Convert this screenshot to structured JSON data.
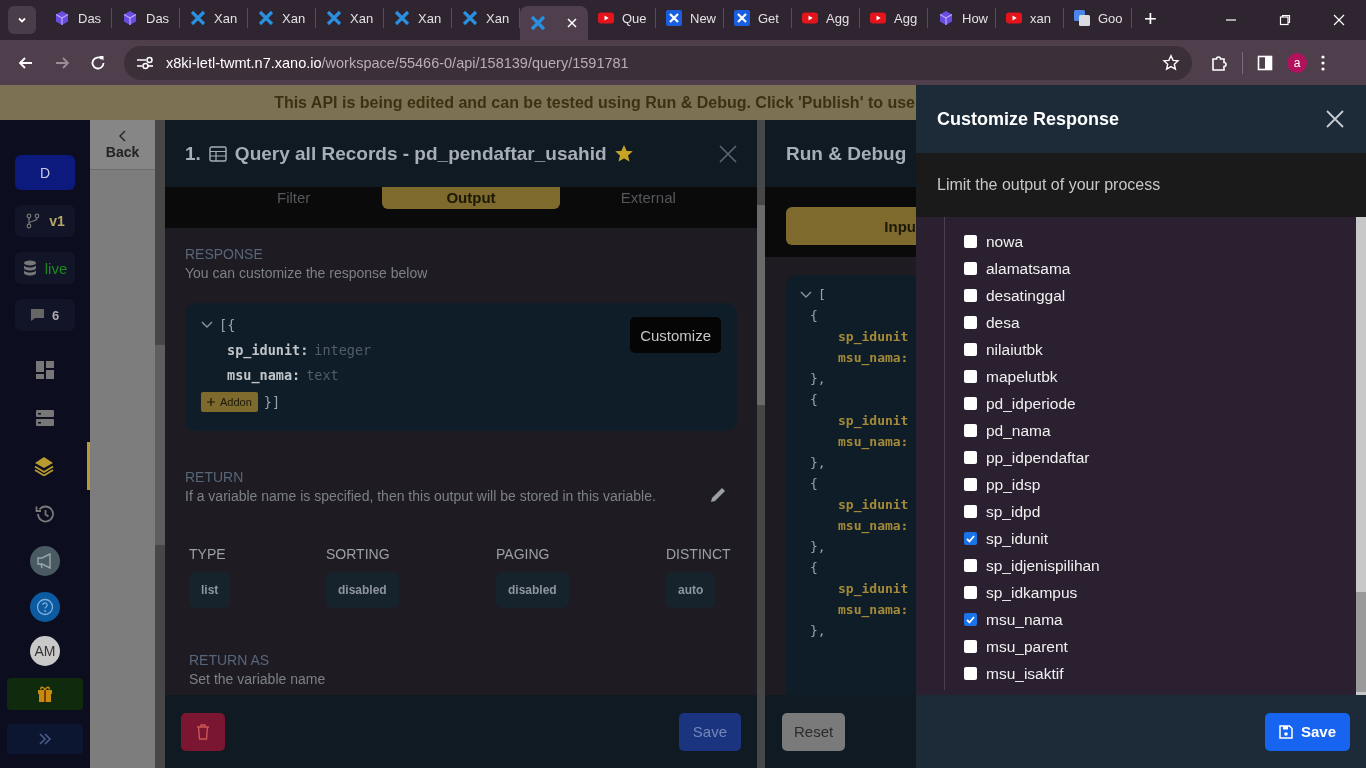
{
  "browser": {
    "tabs": [
      {
        "kind": "cube",
        "label": "Das",
        "selected": false
      },
      {
        "kind": "cube",
        "label": "Das",
        "selected": false
      },
      {
        "kind": "cross",
        "label": "Xan",
        "selected": false
      },
      {
        "kind": "cross",
        "label": "Xan",
        "selected": false
      },
      {
        "kind": "cross",
        "label": "Xan",
        "selected": false
      },
      {
        "kind": "cross",
        "label": "Xan",
        "selected": false
      },
      {
        "kind": "cross",
        "label": "Xan",
        "selected": false
      },
      {
        "kind": "cross",
        "selected": true
      },
      {
        "kind": "video",
        "label": "Que",
        "selected": false
      },
      {
        "kind": "crossbox",
        "label": "New",
        "selected": false
      },
      {
        "kind": "crossbox",
        "label": "Get",
        "selected": false
      },
      {
        "kind": "video",
        "label": "Agg",
        "selected": false
      },
      {
        "kind": "video",
        "label": "Agg",
        "selected": false
      },
      {
        "kind": "cube",
        "label": "How",
        "selected": false
      },
      {
        "kind": "video",
        "label": "xan",
        "selected": false
      },
      {
        "kind": "translate",
        "label": "Goo",
        "selected": false
      }
    ],
    "new_tab": "+",
    "url": {
      "host": "x8ki-letl-twmt.n7.xano.io",
      "path": "/workspace/55466-0/api/158139/query/1591781"
    },
    "profile": "a"
  },
  "banner": "This API is being edited and can be tested using Run & Debug. Click 'Publish' to use",
  "sidebar": {
    "workspace": "D",
    "branch": "v1",
    "environment": "live",
    "comments": "6",
    "nav": [
      {
        "kind": "dashboard",
        "selected": false
      },
      {
        "kind": "database",
        "selected": false
      },
      {
        "kind": "api",
        "selected": true
      },
      {
        "kind": "history",
        "selected": false
      }
    ],
    "avatar": "AM"
  },
  "back": "Back",
  "step": {
    "number": "1.",
    "title": "Query all Records - pd_pendaftar_usahid",
    "favorite": true,
    "tabs": [
      {
        "label": "Filter",
        "selected": false
      },
      {
        "label": "Output",
        "selected": true
      },
      {
        "label": "External",
        "selected": false
      }
    ],
    "response": {
      "heading": "RESPONSE",
      "description": "You can customize the response below",
      "open": "[{",
      "fields": [
        {
          "name": "sp_idunit:",
          "type": "integer"
        },
        {
          "name": "msu_nama:",
          "type": "text"
        }
      ],
      "addon": "Addon",
      "close": "}]",
      "customize": "Customize"
    },
    "return": {
      "heading": "RETURN",
      "description": "If a variable name is specified, then this output will be stored in this variable."
    },
    "settings": [
      {
        "label": "TYPE",
        "value": "list"
      },
      {
        "label": "SORTING",
        "value": "disabled"
      },
      {
        "label": "PAGING",
        "value": "disabled"
      },
      {
        "label": "DISTINCT",
        "value": "auto"
      }
    ],
    "return_as": {
      "heading": "RETURN AS",
      "description": "Set the variable name"
    },
    "save": "Save"
  },
  "run_debug": {
    "title": "Run & Debug",
    "input_tab": "Inpu",
    "open": "[",
    "records": [
      {
        "open": "{",
        "fields": [
          "sp_idunit",
          "msu_nama:"
        ],
        "close": "},"
      },
      {
        "open": "{",
        "fields": [
          "sp_idunit",
          "msu_nama:"
        ],
        "close": "},"
      },
      {
        "open": "{",
        "fields": [
          "sp_idunit",
          "msu_nama:"
        ],
        "close": "},"
      },
      {
        "open": "{",
        "fields": [
          "sp_idunit",
          "msu_nama:"
        ],
        "close": "},"
      }
    ],
    "reset": "Reset"
  },
  "drawer": {
    "title": "Customize Response",
    "subtitle": "Limit the output of your process",
    "fields": [
      {
        "label": "nowa",
        "checked": false
      },
      {
        "label": "alamatsama",
        "checked": false
      },
      {
        "label": "desatinggal",
        "checked": false
      },
      {
        "label": "desa",
        "checked": false
      },
      {
        "label": "nilaiutbk",
        "checked": false
      },
      {
        "label": "mapelutbk",
        "checked": false
      },
      {
        "label": "pd_idperiode",
        "checked": false
      },
      {
        "label": "pd_nama",
        "checked": false
      },
      {
        "label": "pp_idpendaftar",
        "checked": false
      },
      {
        "label": "pp_idsp",
        "checked": false
      },
      {
        "label": "sp_idpd",
        "checked": false
      },
      {
        "label": "sp_idunit",
        "checked": true
      },
      {
        "label": "sp_idjenispilihan",
        "checked": false
      },
      {
        "label": "sp_idkampus",
        "checked": false
      },
      {
        "label": "msu_nama",
        "checked": true
      },
      {
        "label": "msu_parent",
        "checked": false
      },
      {
        "label": "msu_isaktif",
        "checked": false
      }
    ],
    "save": "Save"
  }
}
